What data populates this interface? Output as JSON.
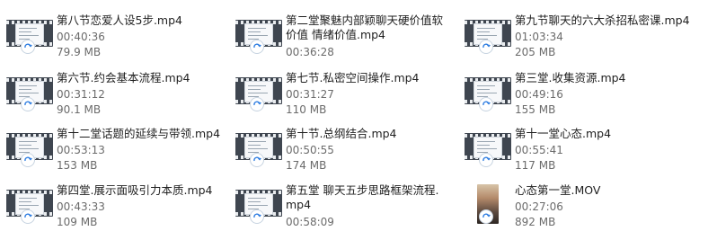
{
  "files": [
    {
      "name": "第八节恋爱人设5步.mp4",
      "duration": "00:40:36",
      "size": "79.9 MB",
      "thumb": "video"
    },
    {
      "name": "第二堂聚魅内部颖聊天硬价值软价值 情绪价值.mp4",
      "duration": "00:36:28",
      "size": "",
      "thumb": "video"
    },
    {
      "name": "第九节聊天的六大杀招私密课.mp4",
      "duration": "01:03:34",
      "size": "205 MB",
      "thumb": "video"
    },
    {
      "name": "第六节.约会基本流程.mp4",
      "duration": "00:31:12",
      "size": "90.1 MB",
      "thumb": "video"
    },
    {
      "name": "第七节.私密空间操作.mp4",
      "duration": "00:31:27",
      "size": "110 MB",
      "thumb": "video"
    },
    {
      "name": "第三堂.收集资源.mp4",
      "duration": "00:49:16",
      "size": "155 MB",
      "thumb": "video"
    },
    {
      "name": "第十二堂话题的延续与带领.mp4",
      "duration": "00:53:13",
      "size": "153 MB",
      "thumb": "video"
    },
    {
      "name": "第十节.总纲结合.mp4",
      "duration": "00:50:55",
      "size": "174 MB",
      "thumb": "video"
    },
    {
      "name": "第十一堂心态.mp4",
      "duration": "00:55:41",
      "size": "117 MB",
      "thumb": "video"
    },
    {
      "name": "第四堂.展示面吸引力本质.mp4",
      "duration": "00:43:33",
      "size": "109 MB",
      "thumb": "video"
    },
    {
      "name": "第五堂 聊天五步思路框架流程.mp4",
      "duration": "00:58:09",
      "size": "",
      "thumb": "video"
    },
    {
      "name": "心态第一堂.MOV",
      "duration": "00:27:06",
      "size": "892 MB",
      "thumb": "photo"
    }
  ],
  "icons": {
    "video_thumb": "video-file-icon",
    "photo_thumb": "video-photo-thumbnail",
    "badge": "cloud-sync-icon"
  },
  "colors": {
    "badge_blue": "#2e7de1",
    "meta_gray": "#6b6b6b"
  }
}
